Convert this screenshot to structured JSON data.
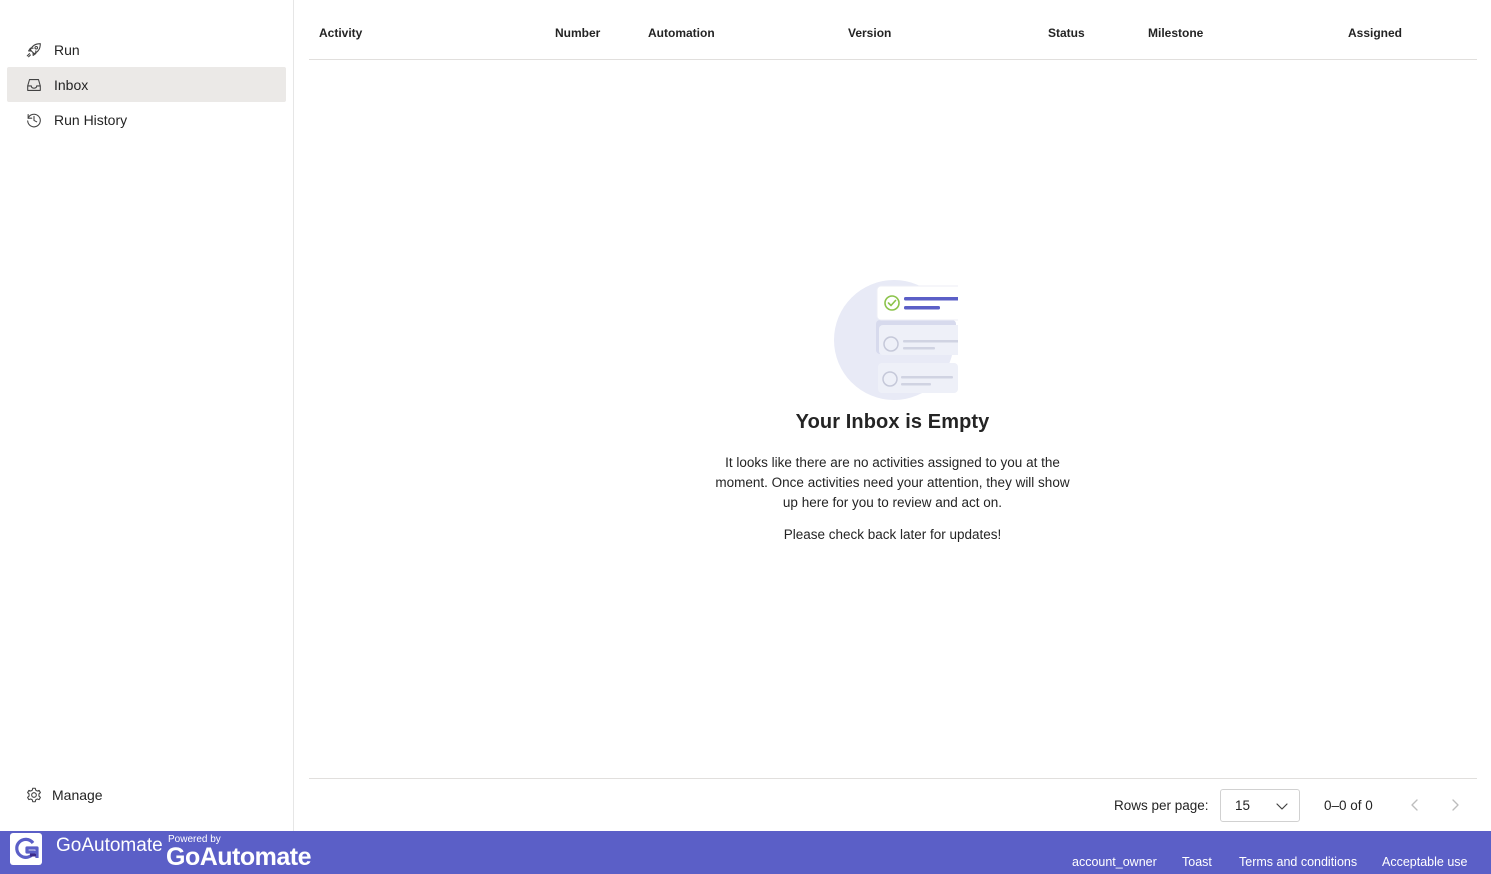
{
  "sidebar": {
    "items": [
      {
        "label": "Run",
        "icon": "rocket-icon"
      },
      {
        "label": "Inbox",
        "icon": "inbox-icon",
        "active": true
      },
      {
        "label": "Run History",
        "icon": "history-icon"
      }
    ],
    "manage_label": "Manage"
  },
  "table": {
    "columns": [
      "Activity",
      "Number",
      "Automation",
      "Version",
      "Status",
      "Milestone",
      "Assigned"
    ]
  },
  "empty_state": {
    "title": "Your Inbox is Empty",
    "text": "It looks like there are no activities assigned to you at the moment. Once activities need your attention, they will show up here for you to review and act on.",
    "later": "Please check back later for updates!"
  },
  "pagination": {
    "rows_label": "Rows per page:",
    "rows_value": "15",
    "range": "0–0 of 0"
  },
  "footer": {
    "app_name": "GoAutomate",
    "powered_by": "Powered by",
    "brand": "GoAutomate",
    "links": [
      "account_owner",
      "Toast",
      "Terms and conditions",
      "Acceptable use"
    ]
  },
  "colors": {
    "accent": "#5b5fc7",
    "sidebar_active": "#ebe9e7",
    "border": "#e1dfdd"
  }
}
